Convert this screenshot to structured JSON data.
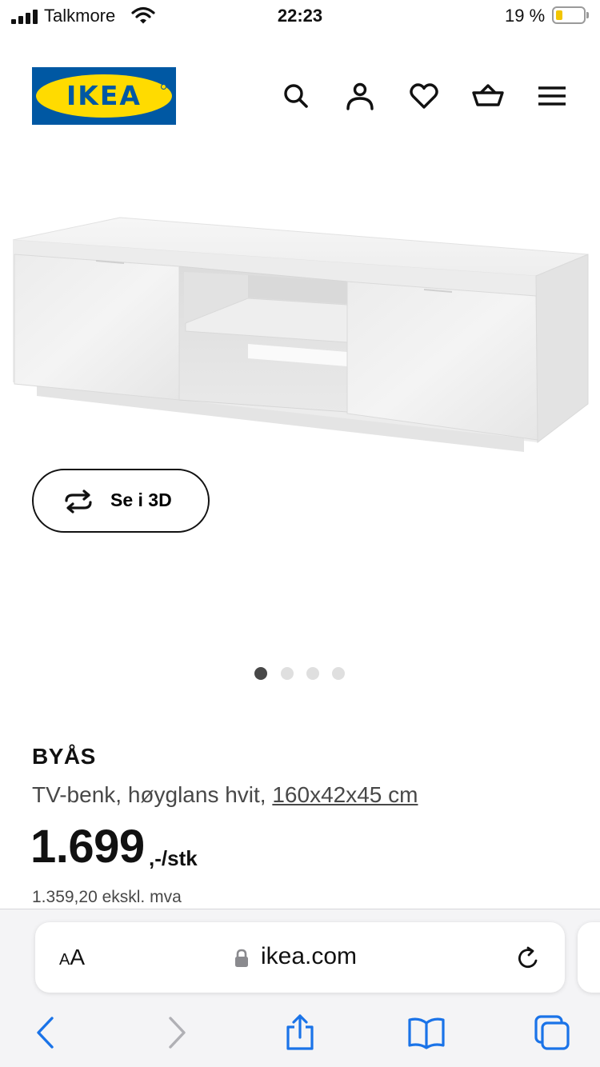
{
  "status_bar": {
    "carrier": "Talkmore",
    "time": "22:23",
    "battery_percent": "19 %",
    "battery_level": 0.19,
    "battery_color": "#f2c500"
  },
  "header": {
    "logo_text": "IKEA",
    "brand_colors": {
      "blue": "#0058a3",
      "yellow": "#ffdb00"
    },
    "icons": [
      "search-icon",
      "account-icon",
      "heart-icon",
      "basket-icon",
      "menu-icon"
    ]
  },
  "gallery": {
    "view_3d_label": "Se i 3D",
    "dot_count": 4,
    "active_dot_index": 0
  },
  "product": {
    "name": "BYÅS",
    "description": "TV-benk, høyglans hvit,",
    "dimensions": "160x42x45 cm",
    "price": "1.699",
    "price_suffix": ",-/stk",
    "price_excl_vat": "1.359,20 ekskl. mva"
  },
  "browser": {
    "text_size_small": "A",
    "text_size_large": "A",
    "url": "ikea.com",
    "accent_color": "#1a73e8",
    "toolbar_icons": [
      "back-icon",
      "forward-icon",
      "share-icon",
      "bookmarks-icon",
      "tabs-icon"
    ]
  }
}
